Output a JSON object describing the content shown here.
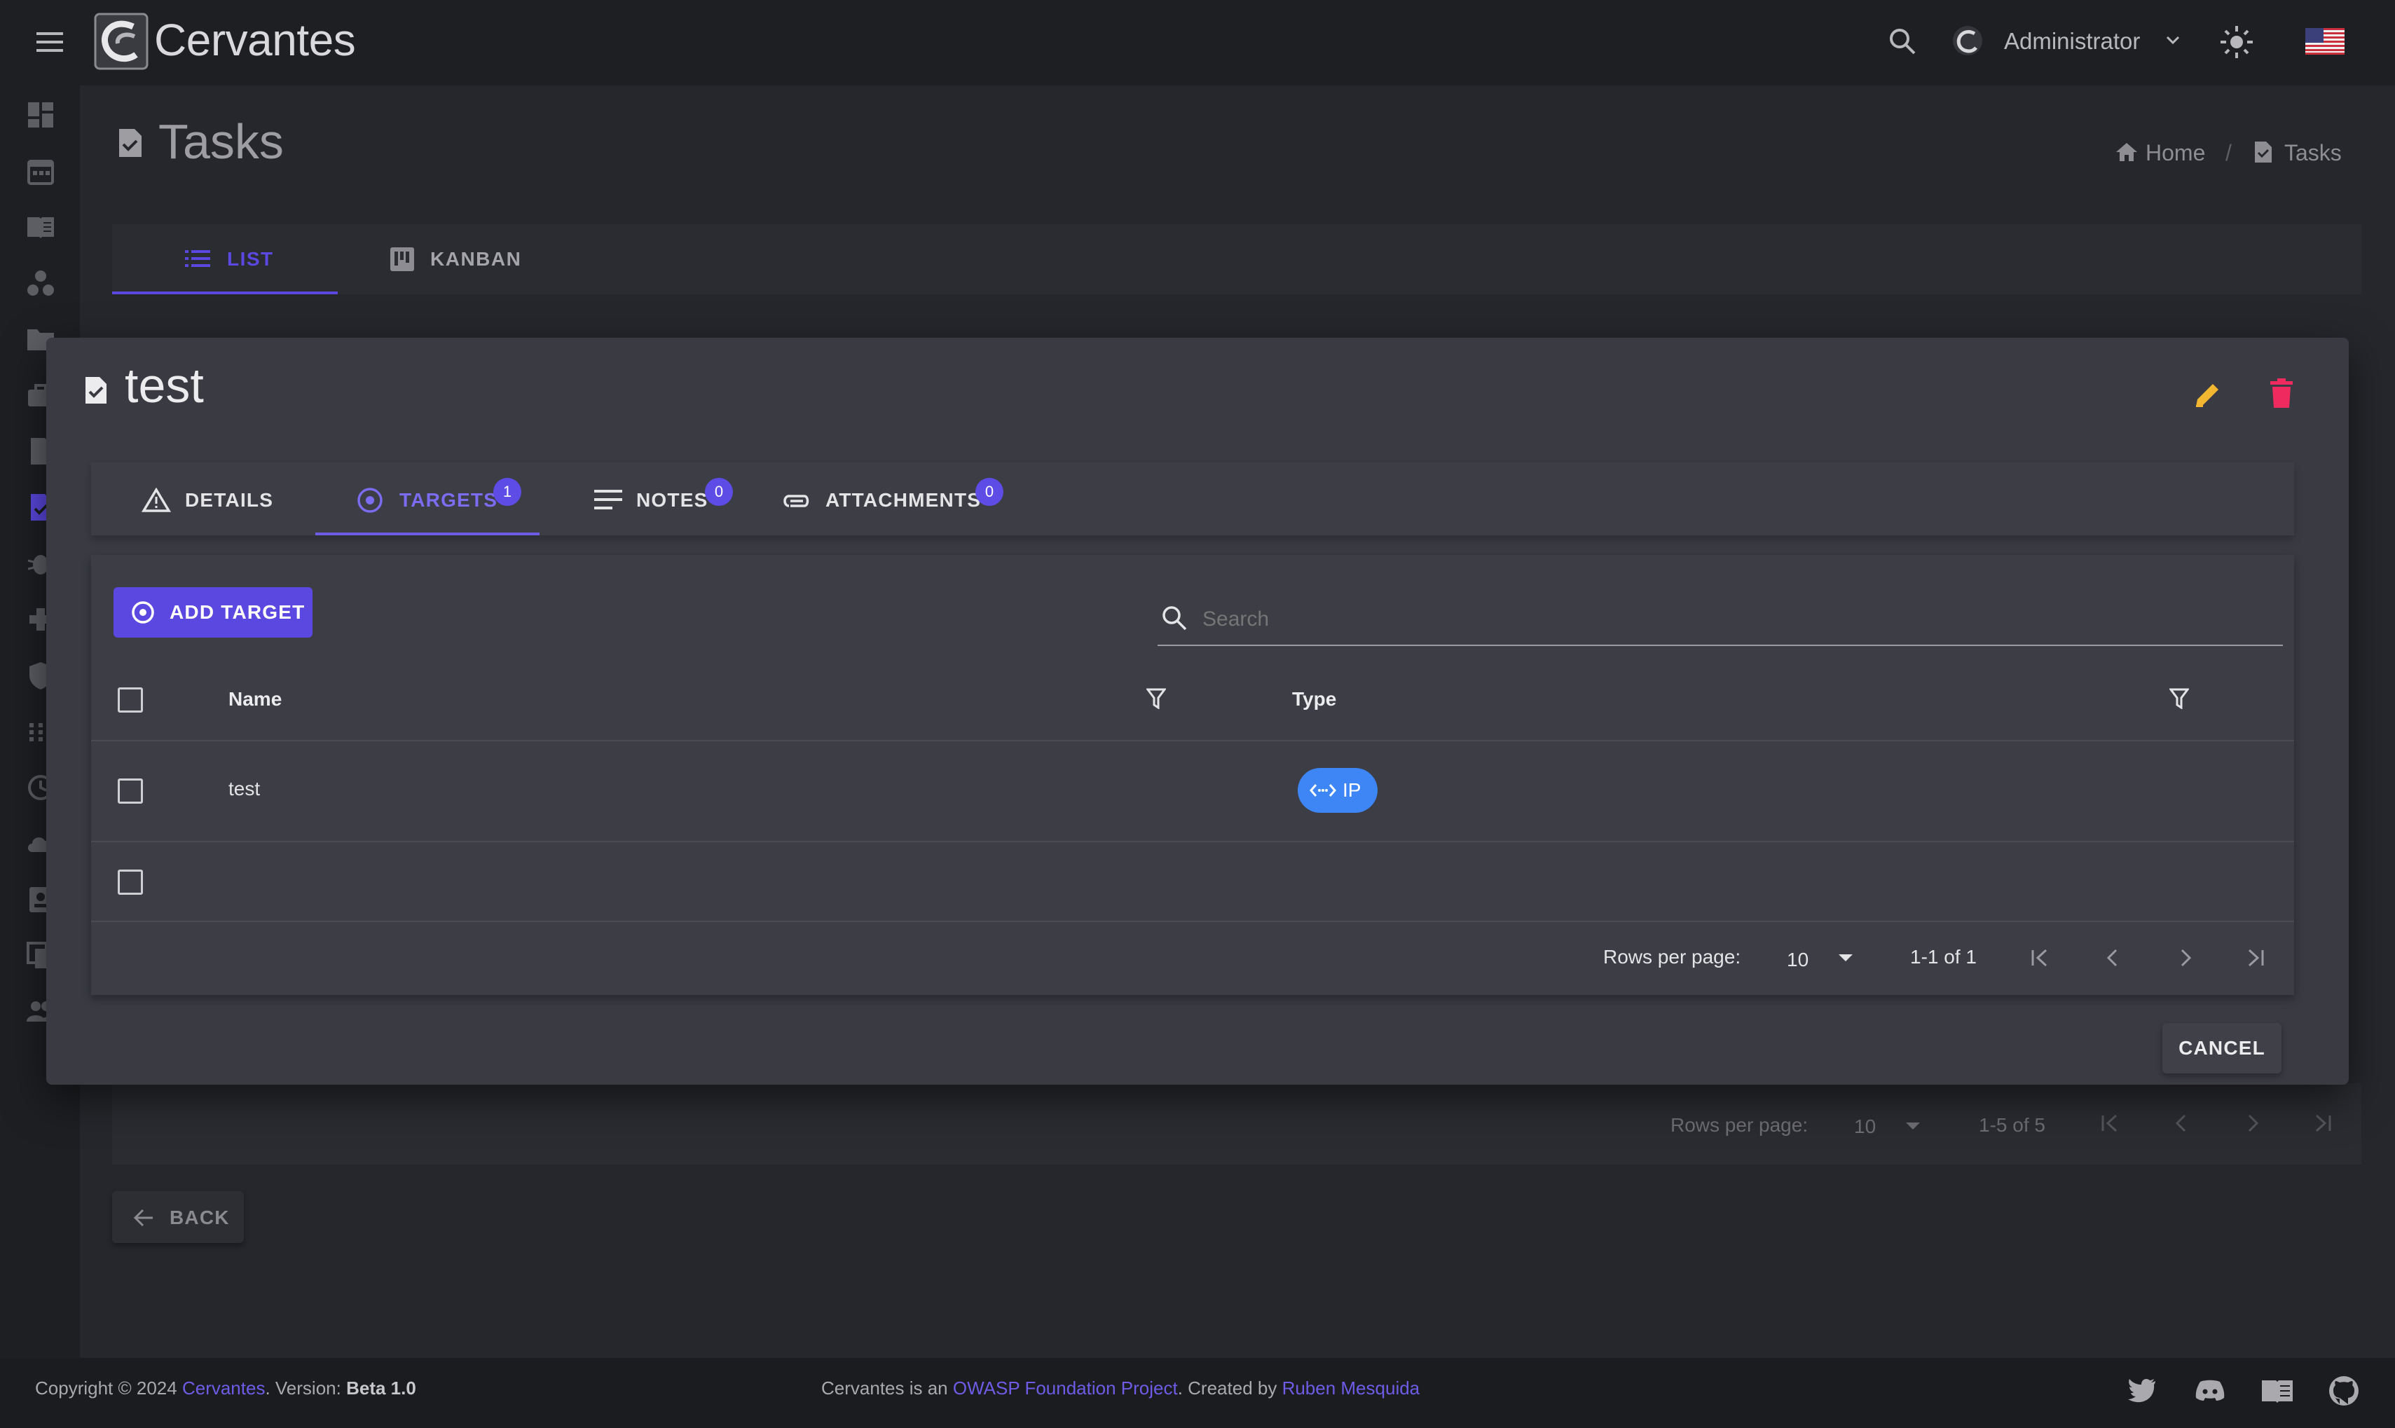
{
  "app": {
    "name": "Cervantes",
    "user": "Administrator"
  },
  "page": {
    "title": "Tasks",
    "breadcrumb": {
      "home": "Home",
      "current": "Tasks"
    },
    "view_tabs": [
      {
        "label": "LIST",
        "active": true
      },
      {
        "label": "KANBAN",
        "active": false
      }
    ],
    "background_pagination": {
      "rows_label": "Rows per page:",
      "rows_value": "10",
      "range": "1-5 of 5"
    },
    "back_label": "BACK"
  },
  "dialog": {
    "title": "test",
    "tabs": [
      {
        "label": "DETAILS",
        "icon": "warning-icon"
      },
      {
        "label": "TARGETS",
        "icon": "target-icon",
        "badge": "1",
        "active": true
      },
      {
        "label": "NOTES",
        "icon": "notes-icon",
        "badge": "0"
      },
      {
        "label": "ATTACHMENTS",
        "icon": "paperclip-icon",
        "badge": "0"
      }
    ],
    "add_button": "ADD TARGET",
    "search_placeholder": "Search",
    "table": {
      "headers": [
        "Name",
        "Type"
      ],
      "rows": [
        {
          "name": "test",
          "type": "IP"
        },
        {
          "name": "",
          "type": ""
        }
      ]
    },
    "pagination": {
      "rows_label": "Rows per page:",
      "rows_value": "10",
      "range": "1-1 of 1"
    },
    "cancel_label": "CANCEL"
  },
  "footer": {
    "copyright_prefix": "Copyright © 2024 ",
    "brand_link": "Cervantes",
    "version_prefix": ". Version: ",
    "version": "Beta 1.0",
    "project_prefix": "Cervantes is an ",
    "project_link": "OWASP Foundation Project",
    "created_prefix": ". Created by ",
    "author_link": "Ruben Mesquida"
  },
  "colors": {
    "accent": "#5b48e0",
    "chip_ip": "#3e86f5",
    "edit": "#f2b630",
    "delete": "#ef2a5e"
  }
}
